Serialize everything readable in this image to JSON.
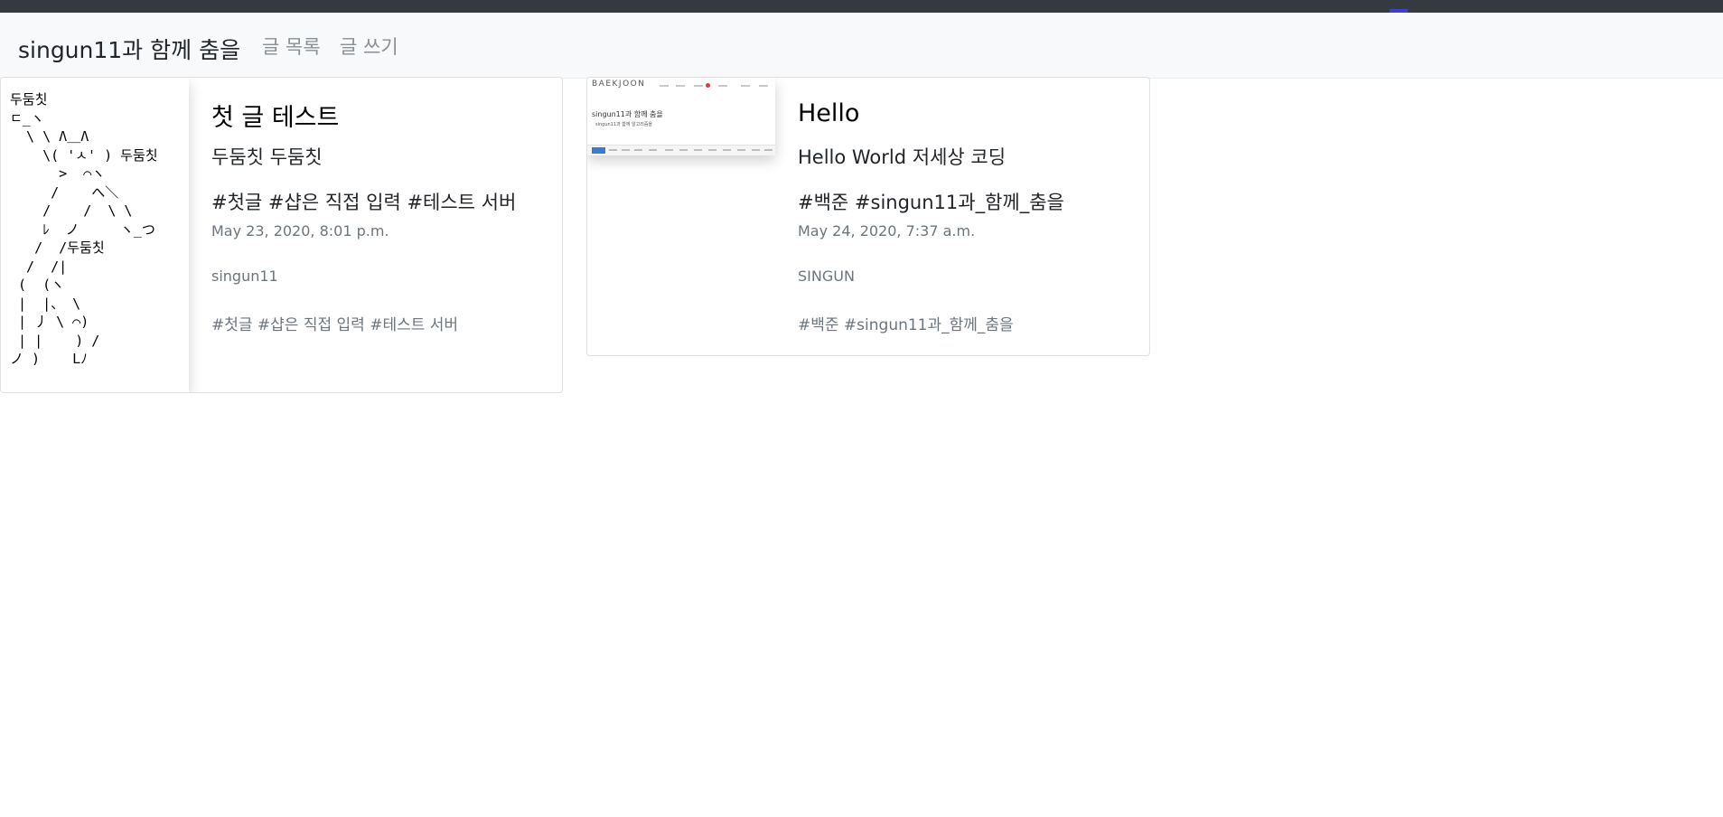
{
  "navbar": {
    "brand": "singun11과 함께 춤을",
    "links": [
      "글 목록",
      "글 쓰기"
    ]
  },
  "posts": [
    {
      "ascii_art": "두둠칫\nㄷ_ヽ\n  \\ \\ Λ＿Λ\n    \\( 'ㅅ' ) 두둠칫\n      >  ⌒ヽ\n     /    へ＼\n    /    /  \\ \\\n    ﾚ  ノ     ヽ_つ\n   /  /두둠칫\n  /  /|\n (  (ヽ\n |  |、 \\\n | 丿 \\ ⌒)\n | |    ) /\nノ )    Lﾉ",
      "title": "첫 글 테스트",
      "subtitle": "두둠칫 두둠칫",
      "hashtags": "#첫글 #샵은 직접 입력 #테스트 서버",
      "date": "May 23, 2020, 8:01 p.m.",
      "author": "singun11",
      "tags": "#첫글 #샵은 직접 입력 #테스트 서버"
    },
    {
      "thumbnail": {
        "logo": "BAEKJOON",
        "heading": "singun11과 함께 춤을",
        "sub": "singun11과 함께 알고리즘을"
      },
      "title": "Hello",
      "subtitle": "Hello World 저세상 코딩",
      "hashtags": "#백준 #singun11과_함께_춤을",
      "date": "May 24, 2020, 7:37 a.m.",
      "author": "SINGUN",
      "tags": "#백준 #singun11과_함께_춤을"
    }
  ],
  "colors": {
    "topbar": "#343a40",
    "navbar": "#f8f9fa",
    "muted": "#6c757d"
  }
}
